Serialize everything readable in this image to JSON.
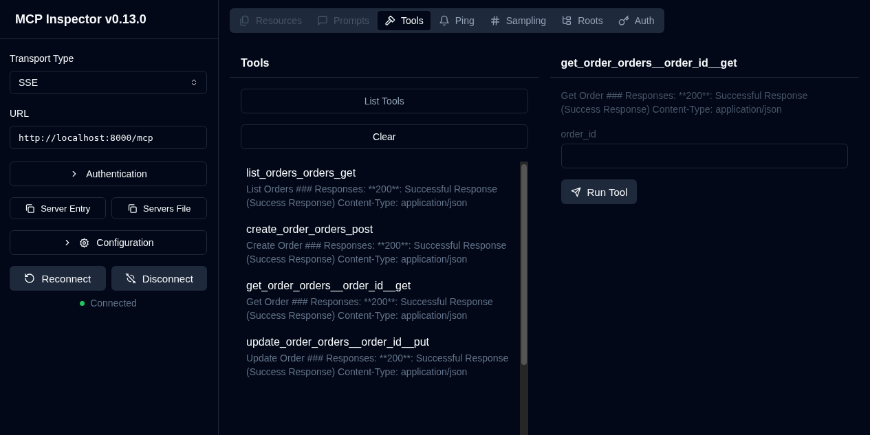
{
  "sidebar": {
    "title": "MCP Inspector v0.13.0",
    "transport": {
      "label": "Transport Type",
      "value": "SSE"
    },
    "url": {
      "label": "URL",
      "value": "http://localhost:8000/mcp"
    },
    "authentication": {
      "label": "Authentication",
      "expanded": false
    },
    "copy_buttons": [
      "Server Entry",
      "Servers File"
    ],
    "configuration": {
      "label": "Configuration",
      "expanded": false
    },
    "reconnect": "Reconnect",
    "disconnect": "Disconnect",
    "status": {
      "label": "Connected",
      "connected": true
    }
  },
  "tabs": [
    {
      "label": "Resources",
      "kind": "resources",
      "selected": false,
      "disabled": true
    },
    {
      "label": "Prompts",
      "kind": "prompts",
      "selected": false,
      "disabled": true
    },
    {
      "label": "Tools",
      "kind": "tools",
      "selected": true,
      "disabled": false
    },
    {
      "label": "Ping",
      "kind": "ping",
      "selected": false,
      "disabled": false
    },
    {
      "label": "Sampling",
      "kind": "sampling",
      "selected": false,
      "disabled": false
    },
    {
      "label": "Roots",
      "kind": "roots",
      "selected": false,
      "disabled": false
    },
    {
      "label": "Auth",
      "kind": "auth",
      "selected": false,
      "disabled": false
    }
  ],
  "tools_panel": {
    "title": "Tools",
    "list_button": "List Tools",
    "clear_button": "Clear",
    "tools": [
      {
        "name": "list_orders_orders_get",
        "description": "List Orders ### Responses: **200**: Successful Response (Success Response) Content-Type: application/json"
      },
      {
        "name": "create_order_orders_post",
        "description": "Create Order ### Responses: **200**: Successful Response (Success Response) Content-Type: application/json"
      },
      {
        "name": "get_order_orders__order_id__get",
        "description": "Get Order ### Responses: **200**: Successful Response (Success Response) Content-Type: application/json"
      },
      {
        "name": "update_order_orders__order_id__put",
        "description": "Update Order ### Responses: **200**: Successful Response (Success Response) Content-Type: application/json"
      }
    ]
  },
  "detail_panel": {
    "title": "get_order_orders__order_id__get",
    "description": "Get Order ### Responses: **200**: Successful Response (Success Response) Content-Type: application/json",
    "field_label": "order_id",
    "run_button": "Run Tool"
  }
}
